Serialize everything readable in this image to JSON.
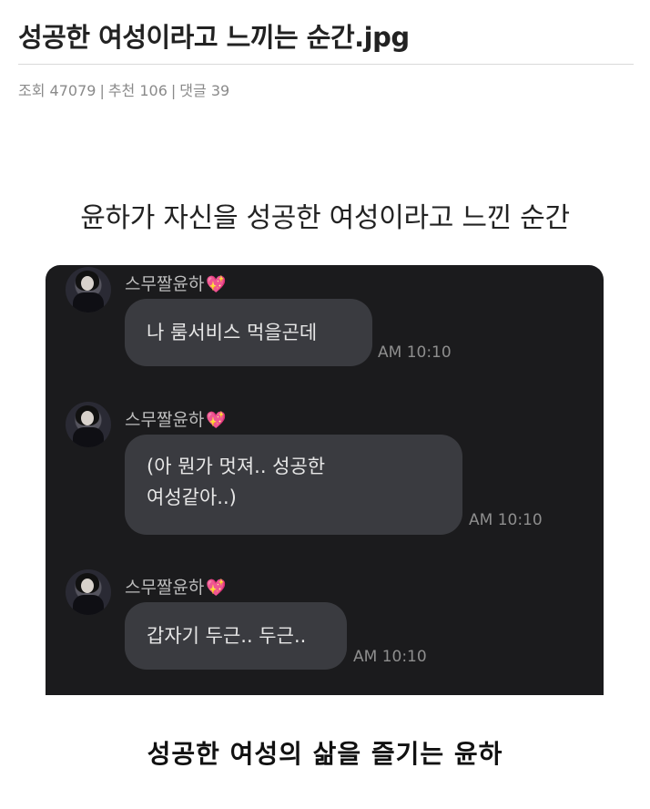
{
  "post": {
    "title": "성공한 여성이라고 느끼는 순간.jpg",
    "views_label": "조회 47079",
    "recommend_label": "추천 106",
    "comments_label": "댓글 39",
    "separator": "|"
  },
  "image": {
    "headline": "윤하가 자신을 성공한 여성이라고 느낀 순간",
    "caption": "성공한 여성의 삶을 즐기는 윤하"
  },
  "chat": {
    "sender_name": "스무짤윤하",
    "heart_icon": "sparkling-heart-icon",
    "heart_color": "#e86ab4",
    "messages": [
      {
        "lines": [
          "나 룸서비스 먹을곤데"
        ],
        "time": "AM 10:10"
      },
      {
        "lines": [
          "(아 뭔가 멋져.. 성공한",
          "여성같아..)"
        ],
        "time": "AM 10:10"
      },
      {
        "lines": [
          "갑자기 두근.. 두근.."
        ],
        "time": "AM 10:10"
      }
    ]
  }
}
